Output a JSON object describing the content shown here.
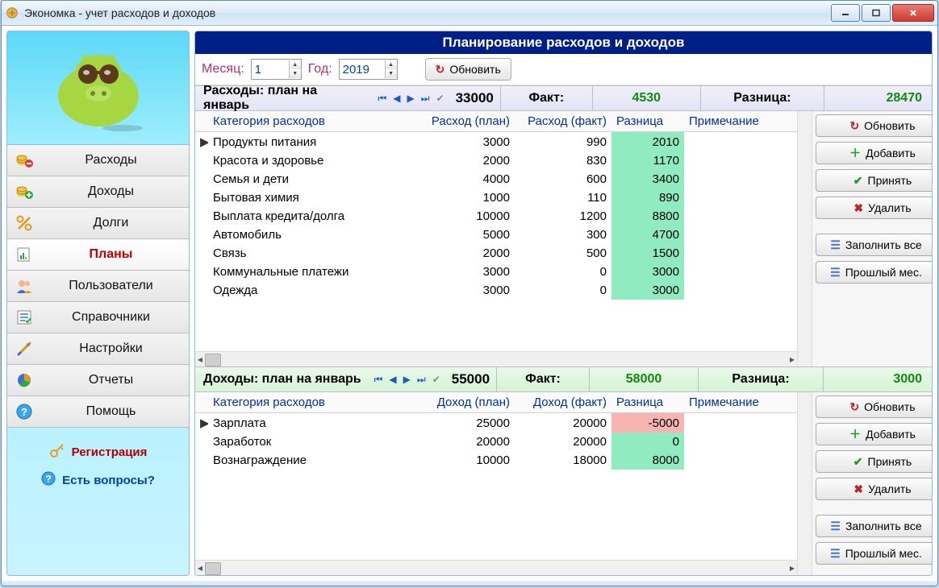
{
  "window": {
    "title": "Экономка - учет расходов и доходов"
  },
  "sidebar": {
    "items": [
      {
        "label": "Расходы"
      },
      {
        "label": "Доходы"
      },
      {
        "label": "Долги"
      },
      {
        "label": "Планы"
      },
      {
        "label": "Пользователи"
      },
      {
        "label": "Справочники"
      },
      {
        "label": "Настройки"
      },
      {
        "label": "Отчеты"
      },
      {
        "label": "Помощь"
      }
    ],
    "registration": "Регистрация",
    "questions": "Есть вопросы?"
  },
  "header": {
    "title": "Планирование расходов и доходов",
    "month_label": "Месяц:",
    "month_value": "1",
    "year_label": "Год:",
    "year_value": "2019",
    "refresh": "Обновить"
  },
  "expense": {
    "label": "Расходы: план на январь",
    "total_plan": "33000",
    "fact_label": "Факт:",
    "fact_value": "4530",
    "diff_label": "Разница:",
    "diff_value": "28470",
    "columns": {
      "cat": "Категория расходов",
      "plan": "Расход (план)",
      "fact": "Расход (факт)",
      "diff": "Разница",
      "note": "Примечание"
    },
    "rows": [
      {
        "cat": "Продукты питания",
        "plan": "3000",
        "fact": "990",
        "diff": "2010"
      },
      {
        "cat": "Красота и здоровье",
        "plan": "2000",
        "fact": "830",
        "diff": "1170"
      },
      {
        "cat": "Семья и дети",
        "plan": "4000",
        "fact": "600",
        "diff": "3400"
      },
      {
        "cat": "Бытовая химия",
        "plan": "1000",
        "fact": "110",
        "diff": "890"
      },
      {
        "cat": "Выплата кредита/долга",
        "plan": "10000",
        "fact": "1200",
        "diff": "8800"
      },
      {
        "cat": "Автомобиль",
        "plan": "5000",
        "fact": "300",
        "diff": "4700"
      },
      {
        "cat": "Связь",
        "plan": "2000",
        "fact": "500",
        "diff": "1500"
      },
      {
        "cat": "Коммунальные платежи",
        "plan": "3000",
        "fact": "0",
        "diff": "3000"
      },
      {
        "cat": "Одежда",
        "plan": "3000",
        "fact": "0",
        "diff": "3000"
      }
    ]
  },
  "income": {
    "label": "Доходы: план на январь",
    "total_plan": "55000",
    "fact_label": "Факт:",
    "fact_value": "58000",
    "diff_label": "Разница:",
    "diff_value": "3000",
    "columns": {
      "cat": "Категория расходов",
      "plan": "Доход (план)",
      "fact": "Доход (факт)",
      "diff": "Разница",
      "note": "Примечание"
    },
    "rows": [
      {
        "cat": "Зарплата",
        "plan": "25000",
        "fact": "20000",
        "diff": "-5000"
      },
      {
        "cat": "Заработок",
        "plan": "20000",
        "fact": "20000",
        "diff": "0"
      },
      {
        "cat": "Вознаграждение",
        "plan": "10000",
        "fact": "18000",
        "diff": "8000"
      }
    ]
  },
  "actions": {
    "refresh": "Обновить",
    "add": "Добавить",
    "accept": "Принять",
    "delete": "Удалить",
    "fill_all": "Заполнить все",
    "prev_month": "Прошлый мес."
  }
}
